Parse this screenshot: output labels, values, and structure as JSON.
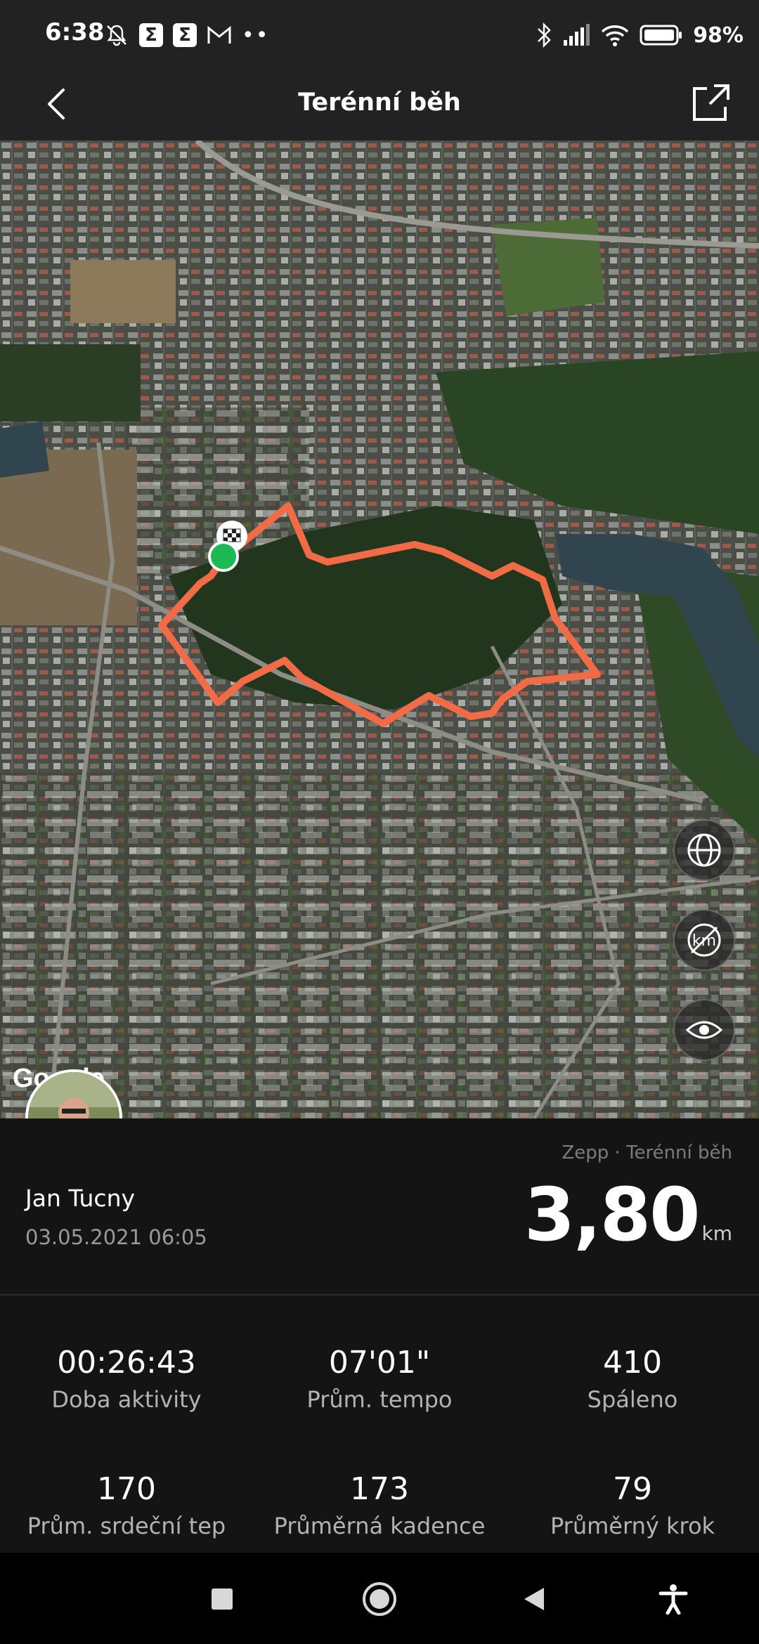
{
  "status_bar": {
    "time": "6:38",
    "battery": "98%",
    "left_icons": [
      "muted-bell-icon",
      "sigma-icon",
      "sigma-icon",
      "gmail-icon",
      "more-dots-icon"
    ],
    "right_icons": [
      "bluetooth-icon",
      "signal-icon",
      "wifi-icon",
      "battery-icon"
    ],
    "sigma_glyph": "Σ",
    "dots": "••"
  },
  "header": {
    "title": "Terénní běh",
    "back_icon": "chevron-left-icon",
    "share_icon": "share-icon"
  },
  "map": {
    "attribution": "Google",
    "controls": [
      "globe-icon",
      "km-toggle-icon",
      "eye-icon"
    ],
    "route_color": "#f26b47",
    "start_color": "#1db954"
  },
  "activity": {
    "user_name": "Jan Tucny",
    "date": "03.05.2021 06:05",
    "source": "Zepp · Terénní běh",
    "distance": "3,80",
    "distance_unit": "km"
  },
  "stats": [
    {
      "value": "00:26:43",
      "label": "Doba aktivity"
    },
    {
      "value": "07'01\"",
      "label": "Prům. tempo"
    },
    {
      "value": "410",
      "label": "Spáleno"
    },
    {
      "value": "170",
      "label": "Prům. srdeční tep"
    },
    {
      "value": "173",
      "label": "Průměrná kadence"
    },
    {
      "value": "79",
      "label": "Průměrný krok"
    }
  ],
  "nav_bar": {
    "buttons": [
      "recents-square-icon",
      "home-circle-icon",
      "back-triangle-icon",
      "accessibility-icon"
    ]
  },
  "colors": {
    "background": "#141414",
    "header": "#222222",
    "accent_route": "#f26b47"
  }
}
